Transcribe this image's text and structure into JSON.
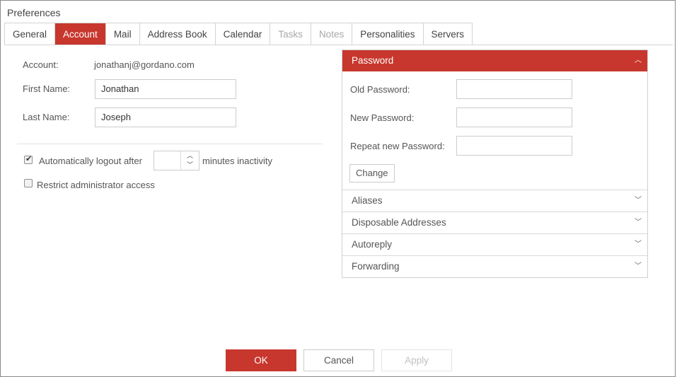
{
  "window": {
    "title": "Preferences"
  },
  "tabs": [
    {
      "label": "General",
      "state": "normal"
    },
    {
      "label": "Account",
      "state": "active"
    },
    {
      "label": "Mail",
      "state": "normal"
    },
    {
      "label": "Address Book",
      "state": "normal"
    },
    {
      "label": "Calendar",
      "state": "normal"
    },
    {
      "label": "Tasks",
      "state": "disabled"
    },
    {
      "label": "Notes",
      "state": "disabled"
    },
    {
      "label": "Personalities",
      "state": "normal"
    },
    {
      "label": "Servers",
      "state": "normal"
    }
  ],
  "account": {
    "account_label": "Account:",
    "account_value": "jonathanj@gordano.com",
    "first_name_label": "First Name:",
    "first_name_value": "Jonathan",
    "last_name_label": "Last Name:",
    "last_name_value": "Joseph"
  },
  "options": {
    "auto_logout_label": "Automatically logout after",
    "auto_logout_checked": true,
    "auto_logout_value": "",
    "auto_logout_suffix": "minutes inactivity",
    "restrict_admin_label": "Restrict administrator access",
    "restrict_admin_checked": false
  },
  "password_panel": {
    "title": "Password",
    "old_label": "Old Password:",
    "new_label": "New Password:",
    "repeat_label": "Repeat new Password:",
    "change_button": "Change",
    "expanded": true
  },
  "accordion": [
    {
      "label": "Aliases"
    },
    {
      "label": "Disposable Addresses"
    },
    {
      "label": "Autoreply"
    },
    {
      "label": "Forwarding"
    }
  ],
  "footer": {
    "ok": "OK",
    "cancel": "Cancel",
    "apply": "Apply",
    "apply_enabled": false
  },
  "colors": {
    "accent": "#c8372d",
    "text": "#555555",
    "border": "#cccccc"
  },
  "icons": {
    "expanded": "chevron-up-icon",
    "collapsed": "chevron-down-icon",
    "checked": "checkmark-icon"
  }
}
